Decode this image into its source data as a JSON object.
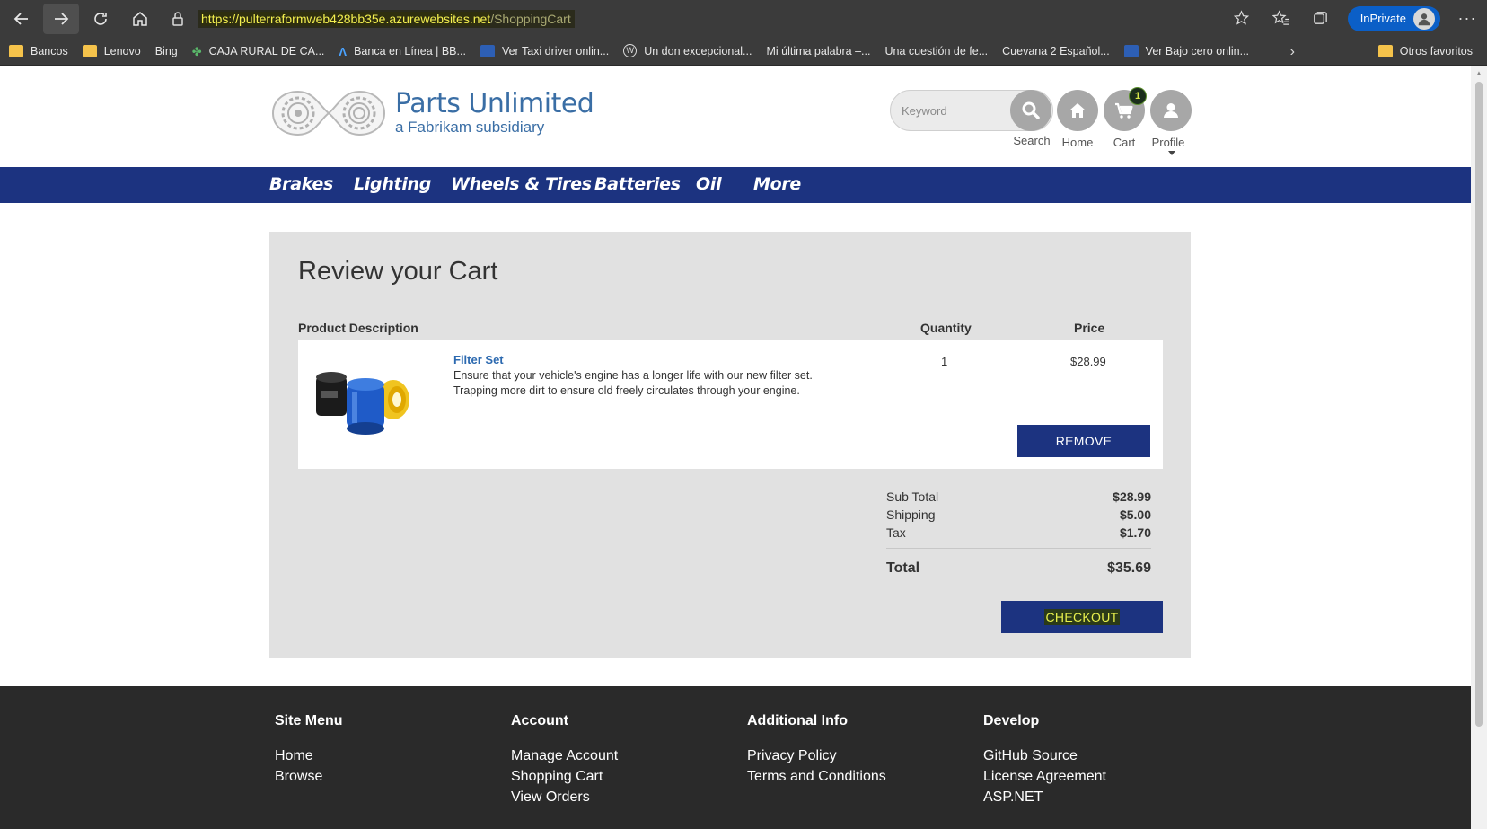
{
  "browser": {
    "url_host": "https://pulterraformweb428bb35e.azurewebsites.net",
    "url_path": "/ShoppingCart",
    "inprivate_label": "InPrivate",
    "favorites": [
      {
        "label": "Bancos",
        "icon": "folder-icon"
      },
      {
        "label": "Lenovo",
        "icon": "folder-icon"
      },
      {
        "label": "Bing",
        "icon": "page-icon"
      },
      {
        "label": "CAJA RURAL DE CA...",
        "icon": "leaf-icon"
      },
      {
        "label": "Banca en Línea | BB...",
        "icon": "bank-icon"
      },
      {
        "label": "Ver Taxi driver onlin...",
        "icon": "video-icon"
      },
      {
        "label": "Un don excepcional...",
        "icon": "wordpress-icon"
      },
      {
        "label": "Mi última palabra –...",
        "icon": "page-icon"
      },
      {
        "label": "Una cuestión de fe...",
        "icon": "page-icon"
      },
      {
        "label": "Cuevana 2 Español...",
        "icon": "page-icon"
      },
      {
        "label": "Ver Bajo cero onlin...",
        "icon": "video-icon"
      }
    ],
    "other_favorites": "Otros favoritos"
  },
  "header": {
    "logo_title": "Parts Unlimited",
    "logo_subtitle": "a Fabrikam subsidiary",
    "search_placeholder": "Keyword",
    "search_label": "Search",
    "home_label": "Home",
    "cart_label": "Cart",
    "cart_count": "1",
    "profile_label": "Profile"
  },
  "nav": {
    "items": [
      "Brakes",
      "Lighting",
      "Wheels & Tires",
      "Batteries",
      "Oil",
      "More"
    ]
  },
  "cart": {
    "title": "Review your Cart",
    "col_product": "Product Description",
    "col_quantity": "Quantity",
    "col_price": "Price",
    "item": {
      "name": "Filter Set",
      "description": "Ensure that your vehicle's engine has a longer life with our new filter set. Trapping more dirt to ensure old freely circulates through your engine.",
      "quantity": "1",
      "price": "$28.99",
      "remove_label": "REMOVE"
    },
    "summary": {
      "subtotal_label": "Sub Total",
      "subtotal": "$28.99",
      "shipping_label": "Shipping",
      "shipping": "$5.00",
      "tax_label": "Tax",
      "tax": "$1.70",
      "total_label": "Total",
      "total": "$35.69"
    },
    "checkout_label": "CHECKOUT"
  },
  "footer": {
    "columns": [
      {
        "title": "Site Menu",
        "links": [
          "Home",
          "Browse"
        ]
      },
      {
        "title": "Account",
        "links": [
          "Manage Account",
          "Shopping Cart",
          "View Orders"
        ]
      },
      {
        "title": "Additional Info",
        "links": [
          "Privacy Policy",
          "Terms and Conditions"
        ]
      },
      {
        "title": "Develop",
        "links": [
          "GitHub Source",
          "License Agreement",
          "ASP.NET"
        ]
      }
    ]
  },
  "colors": {
    "nav_blue": "#1c3380",
    "logo_blue": "#3a6ea5",
    "panel_gray": "#e1e1e1",
    "footer_dark": "#2a2a2a"
  }
}
